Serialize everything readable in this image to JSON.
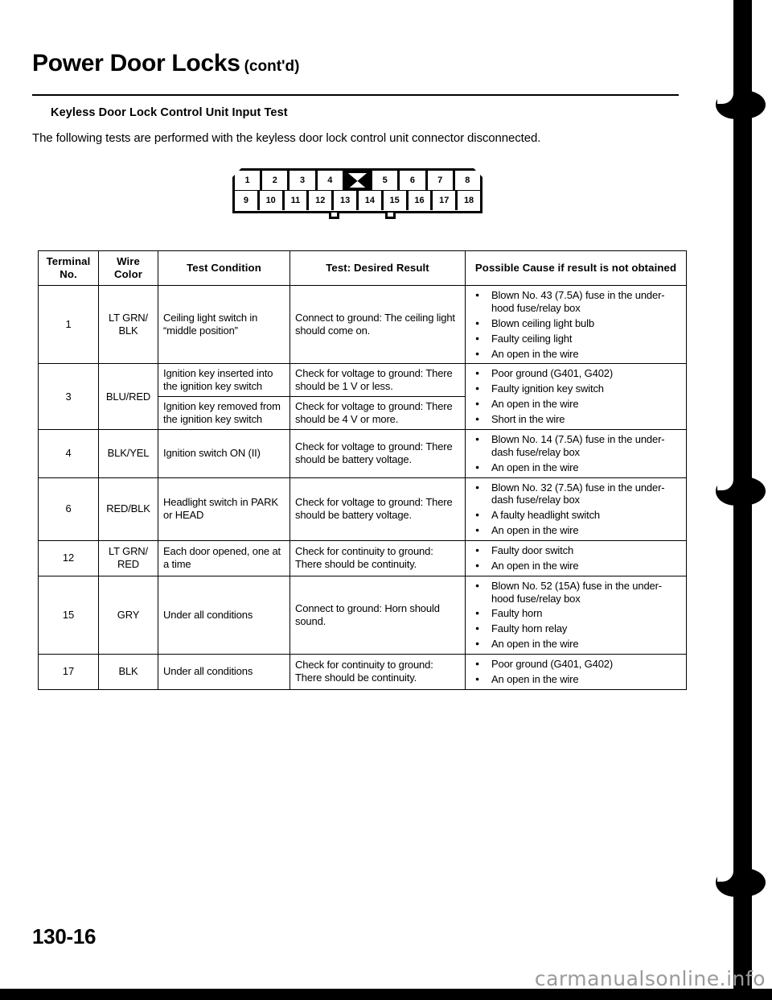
{
  "header": {
    "title": "Power Door Locks",
    "continued": "(cont'd)",
    "section_heading": "Keyless Door Lock Control Unit Input Test",
    "intro": "The following tests are performed with the keyless door lock control unit connector disconnected."
  },
  "connector": {
    "top_row": [
      "1",
      "2",
      "3",
      "4",
      "",
      "5",
      "6",
      "7",
      "8"
    ],
    "bottom_row": [
      "9",
      "10",
      "11",
      "12",
      "13",
      "14",
      "15",
      "16",
      "17",
      "18"
    ],
    "key_slot_index": 4
  },
  "table": {
    "columns": [
      "Terminal\nNo.",
      "Wire\nColor",
      "Test Condition",
      "Test: Desired Result",
      "Possible Cause if result is not obtained"
    ],
    "columns_flat": {
      "terminal_no_line1": "Terminal",
      "terminal_no_line2": "No.",
      "wire_color_line1": "Wire",
      "wire_color_line2": "Color",
      "test_condition": "Test Condition",
      "desired_result": "Test: Desired Result",
      "possible_cause": "Possible Cause if result is not obtained"
    },
    "rows": [
      {
        "terminal": "1",
        "wire_color": "LT GRN/\nBLK",
        "wire_color_l1": "LT GRN/",
        "wire_color_l2": "BLK",
        "conditions": [
          {
            "test_condition": "Ceiling light switch in “middle position”",
            "desired_result": "Connect to ground:  The ceiling light should come on."
          }
        ],
        "causes": [
          "Blown No. 43 (7.5A) fuse in the under-hood fuse/relay box",
          "Blown ceiling light bulb",
          "Faulty ceiling light",
          "An open in the wire"
        ]
      },
      {
        "terminal": "3",
        "wire_color": "BLU/RED",
        "wire_color_l1": "BLU/RED",
        "wire_color_l2": "",
        "conditions": [
          {
            "test_condition": "Ignition key inserted into the ignition key switch",
            "desired_result": "Check for voltage to ground: There should be 1 V or less."
          },
          {
            "test_condition": "Ignition key removed from the ignition key switch",
            "desired_result": "Check for voltage to ground: There should be 4 V or more."
          }
        ],
        "causes": [
          "Poor ground (G401, G402)",
          "Faulty ignition key switch",
          "An open in the wire",
          "Short in the wire"
        ]
      },
      {
        "terminal": "4",
        "wire_color": "BLK/YEL",
        "wire_color_l1": "BLK/YEL",
        "wire_color_l2": "",
        "conditions": [
          {
            "test_condition": "Ignition switch ON (II)",
            "desired_result": "Check for voltage to ground: There should be battery voltage."
          }
        ],
        "causes": [
          "Blown No. 14 (7.5A) fuse in the under-dash fuse/relay box",
          "An open in the wire"
        ]
      },
      {
        "terminal": "6",
        "wire_color": "RED/BLK",
        "wire_color_l1": "RED/BLK",
        "wire_color_l2": "",
        "conditions": [
          {
            "test_condition": "Headlight switch in PARK or HEAD",
            "desired_result": "Check for voltage to ground: There should be battery voltage."
          }
        ],
        "causes": [
          "Blown No. 32 (7.5A) fuse in the under-dash fuse/relay box",
          "A faulty headlight switch",
          "An open in the wire"
        ]
      },
      {
        "terminal": "12",
        "wire_color": "LT GRN/\nRED",
        "wire_color_l1": "LT GRN/",
        "wire_color_l2": "RED",
        "conditions": [
          {
            "test_condition": "Each door opened, one at a time",
            "desired_result": "Check for continuity to ground: There should be continuity."
          }
        ],
        "causes": [
          "Faulty door switch",
          "An open in the wire"
        ]
      },
      {
        "terminal": "15",
        "wire_color": "GRY",
        "wire_color_l1": "GRY",
        "wire_color_l2": "",
        "conditions": [
          {
            "test_condition": "Under all conditions",
            "desired_result": "Connect to ground: Horn should sound."
          }
        ],
        "causes": [
          "Blown No. 52 (15A) fuse in the under-hood fuse/relay box",
          "Faulty horn",
          "Faulty horn relay",
          "An open in the wire"
        ]
      },
      {
        "terminal": "17",
        "wire_color": "BLK",
        "wire_color_l1": "BLK",
        "wire_color_l2": "",
        "conditions": [
          {
            "test_condition": "Under all conditions",
            "desired_result": "Check for continuity to ground: There should be continuity."
          }
        ],
        "causes": [
          "Poor ground (G401, G402)",
          "An open in the wire"
        ]
      }
    ]
  },
  "footer": {
    "page_number": "130-16",
    "watermark": "carmanualsonline.info"
  }
}
